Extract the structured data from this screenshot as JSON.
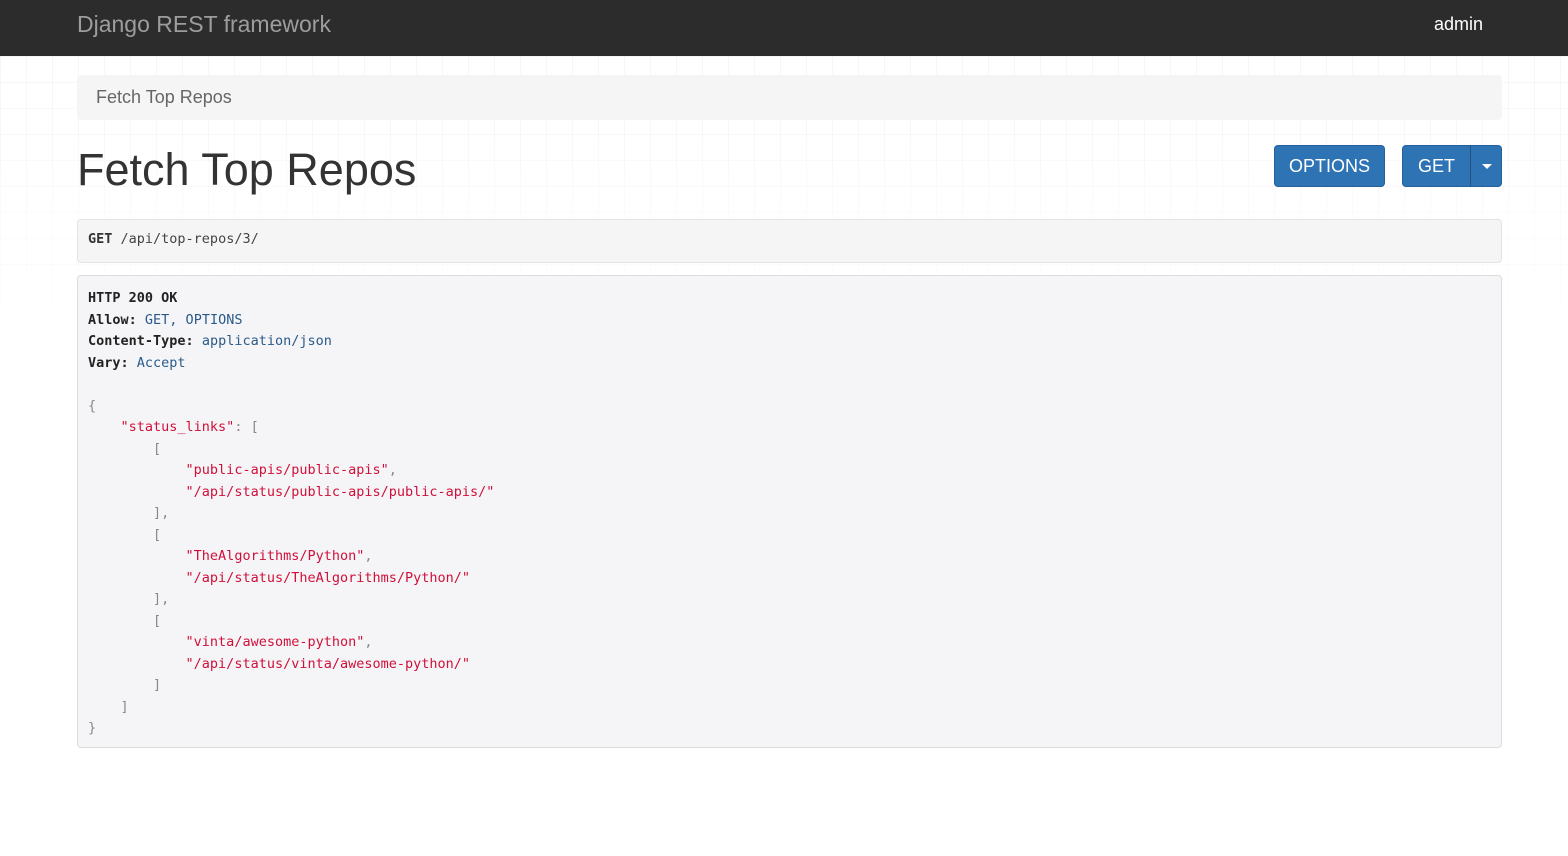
{
  "navbar": {
    "brand": "Django REST framework",
    "user": "admin"
  },
  "breadcrumb": {
    "label": "Fetch Top Repos"
  },
  "page": {
    "title": "Fetch Top Repos"
  },
  "buttons": {
    "options_label": "OPTIONS",
    "get_label": "GET"
  },
  "request": {
    "method": "GET",
    "path": "/api/top-repos/3/"
  },
  "response": {
    "status_line": "HTTP 200 OK",
    "headers": [
      {
        "key": "Allow:",
        "value": "GET, OPTIONS"
      },
      {
        "key": "Content-Type:",
        "value": "application/json"
      },
      {
        "key": "Vary:",
        "value": "Accept"
      }
    ],
    "body_key": "\"status_links\"",
    "status_links": [
      [
        "\"public-apis/public-apis\"",
        "\"/api/status/public-apis/public-apis/\""
      ],
      [
        "\"TheAlgorithms/Python\"",
        "\"/api/status/TheAlgorithms/Python/\""
      ],
      [
        "\"vinta/awesome-python\"",
        "\"/api/status/vinta/awesome-python/\""
      ]
    ]
  },
  "colors": {
    "navbar_bg": "#2c2c2c",
    "button_primary": "#2e74b5",
    "json_string": "#d0103a"
  }
}
